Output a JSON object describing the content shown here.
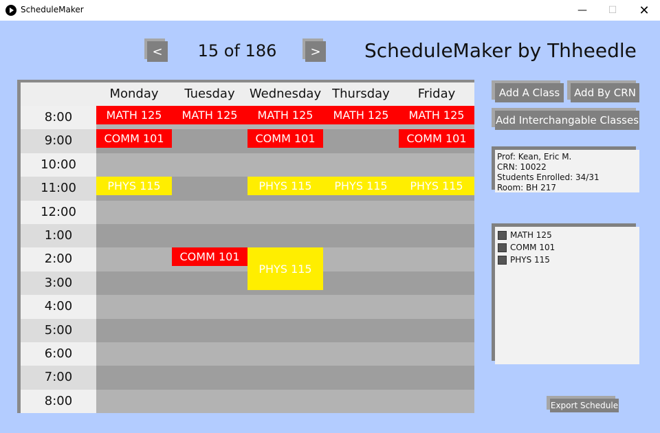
{
  "window": {
    "title": "ScheduleMaker",
    "minimize": "—",
    "maximize": "☐",
    "close": "✕"
  },
  "nav": {
    "prev": "<",
    "next": ">",
    "counter": "15 of 186"
  },
  "brand": "ScheduleMaker by Thheedle",
  "days": [
    "Monday",
    "Tuesday",
    "Wednesday",
    "Thursday",
    "Friday"
  ],
  "times": [
    "8:00",
    "9:00",
    "10:00",
    "11:00",
    "12:00",
    "1:00",
    "2:00",
    "3:00",
    "4:00",
    "5:00",
    "6:00",
    "7:00",
    "8:00"
  ],
  "events": [
    {
      "label": "MATH 125",
      "day": 0,
      "color": "red"
    },
    {
      "label": "MATH 125",
      "day": 1,
      "color": "red"
    },
    {
      "label": "MATH 125",
      "day": 2,
      "color": "red"
    },
    {
      "label": "MATH 125",
      "day": 3,
      "color": "red"
    },
    {
      "label": "MATH 125",
      "day": 4,
      "color": "red"
    },
    {
      "label": "COMM 101",
      "day": 0,
      "color": "red"
    },
    {
      "label": "COMM 101",
      "day": 2,
      "color": "red"
    },
    {
      "label": "COMM 101",
      "day": 4,
      "color": "red"
    },
    {
      "label": "PHYS 115",
      "day": 0,
      "color": "yellow"
    },
    {
      "label": "PHYS 115",
      "day": 2,
      "color": "yellow"
    },
    {
      "label": "PHYS 115",
      "day": 3,
      "color": "yellow"
    },
    {
      "label": "PHYS 115",
      "day": 4,
      "color": "yellow"
    },
    {
      "label": "COMM 101",
      "day": 1,
      "color": "red"
    },
    {
      "label": "PHYS 115",
      "day": 2,
      "color": "yellow"
    }
  ],
  "buttons": {
    "add_class": "Add A Class",
    "add_crn": "Add By CRN",
    "add_interchangeable": "Add Interchangable Classes",
    "export": "Export Schedule"
  },
  "info": {
    "prof": "Prof: Kean, Eric M.",
    "crn": "CRN: 10022",
    "enrolled": "Students Enrolled: 34/31",
    "room": "Room: BH 217"
  },
  "class_list": [
    "MATH 125",
    "COMM 101",
    "PHYS 115"
  ],
  "colors": {
    "background": "#b3ccff",
    "red": "#ff0000",
    "yellow": "#ffee00",
    "band_light": "#b3b3b3",
    "band_dark": "#9e9e9e",
    "button": "#808080"
  }
}
